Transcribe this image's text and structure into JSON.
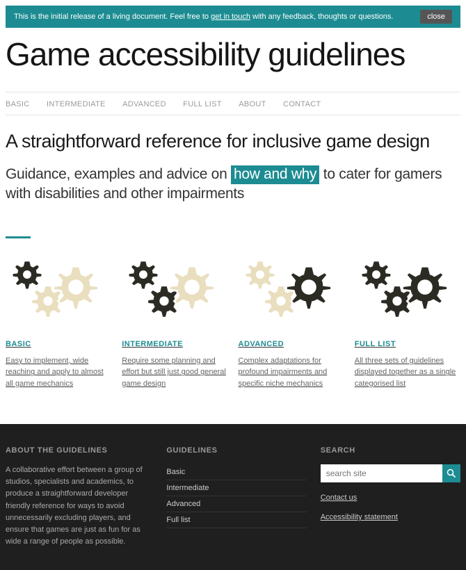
{
  "banner": {
    "text_before": "This is the initial release of a living document. Feel free to ",
    "link": "get in touch",
    "text_after": " with any feedback, thoughts or questions.",
    "close": "close"
  },
  "site_title": "Game accessibility guidelines",
  "nav": {
    "basic": "BASIC",
    "intermediate": "INTERMEDIATE",
    "advanced": "ADVANCED",
    "full_list": "FULL LIST",
    "about": "ABOUT",
    "contact": "CONTACT"
  },
  "tagline": "A straightforward reference for inclusive game design",
  "sub": {
    "before": "Guidance, examples and advice on ",
    "highlight": "how and why",
    "after": " to cater for gamers with disabilities and other impairments"
  },
  "cards": {
    "basic": {
      "title": "BASIC",
      "desc": "Easy to implement, wide reaching and apply to almost all game mechanics"
    },
    "inter": {
      "title": "INTERMEDIATE",
      "desc": "Require some planning and effort but still just good general game design"
    },
    "adv": {
      "title": "ADVANCED",
      "desc": "Complex adaptations for profound impairments and specific niche mechanics"
    },
    "full": {
      "title": "FULL LIST",
      "desc": "All three sets of guidelines displayed together as a single categorised list"
    }
  },
  "footer": {
    "about": {
      "title": "ABOUT THE GUIDELINES",
      "body": "A collaborative effort between a group of studios, specialists and academics, to produce a straightforward developer friendly reference for ways to avoid unnecessarily excluding players, and ensure that games are just as fun for as wide a range of people as possible."
    },
    "guides": {
      "title": "GUIDELINES",
      "basic": "Basic",
      "intermediate": "Intermediate",
      "advanced": "Advanced",
      "full": "Full list"
    },
    "search": {
      "title": "SEARCH",
      "placeholder": "search site",
      "contact": "Contact us",
      "access": "Accessibility statement"
    }
  }
}
